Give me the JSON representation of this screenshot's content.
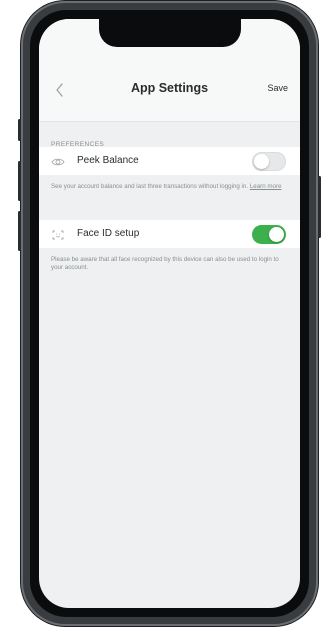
{
  "header": {
    "title": "App Settings",
    "save_label": "Save",
    "back_icon": "chevron-left-icon"
  },
  "section": {
    "label": "PREFERENCES"
  },
  "settings": [
    {
      "label": "Peek Balance",
      "icon": "eye-icon",
      "enabled": false,
      "description": "See your account balance and last three transactions without logging in.",
      "link": "Learn more"
    },
    {
      "label": "Face ID setup",
      "icon": "face-id-icon",
      "enabled": true,
      "description": "Please be aware that all face recognized by this device can also be used to login to your account."
    }
  ],
  "colors": {
    "toggle_on": "#3cb04c",
    "toggle_off": "#e6e8e9",
    "screen_bg": "#eef0f1"
  }
}
